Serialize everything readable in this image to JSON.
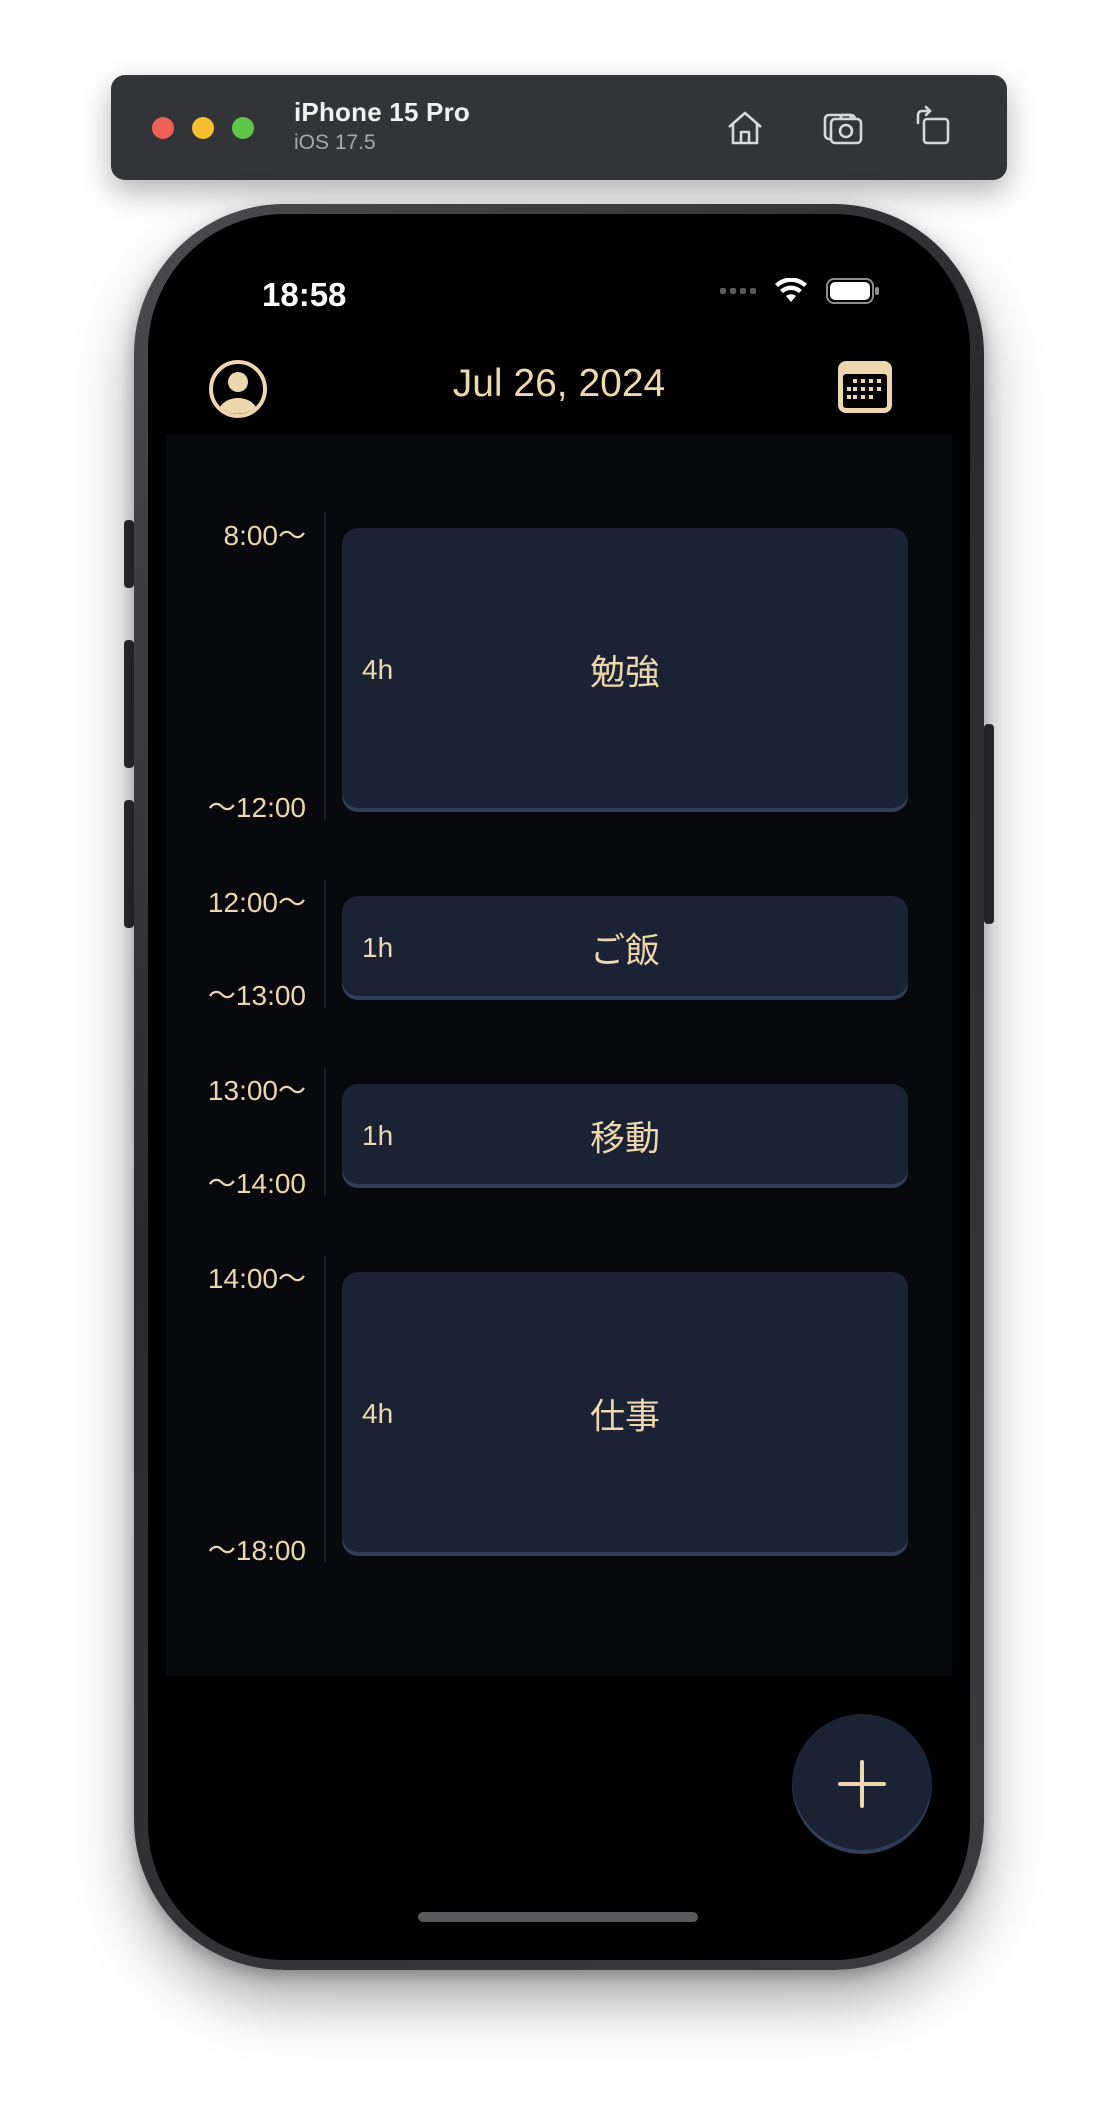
{
  "simulator": {
    "device_name": "iPhone 15 Pro",
    "os_version": "iOS 17.5",
    "buttons": [
      {
        "icon": "home-icon"
      },
      {
        "icon": "screenshot-icon"
      },
      {
        "icon": "rotate-icon"
      }
    ]
  },
  "status_bar": {
    "time": "18:58",
    "icons": [
      "cellular-signal-icon",
      "wifi-icon",
      "battery-icon"
    ]
  },
  "header": {
    "date": "Jul 26, 2024",
    "left_icon": "profile-icon",
    "right_icon": "calendar-icon"
  },
  "schedule": [
    {
      "start": "8:00〜",
      "end": "〜12:00",
      "duration": "4h",
      "title": "勉強"
    },
    {
      "start": "12:00〜",
      "end": "〜13:00",
      "duration": "1h",
      "title": "ご飯"
    },
    {
      "start": "13:00〜",
      "end": "〜14:00",
      "duration": "1h",
      "title": "移動"
    },
    {
      "start": "14:00〜",
      "end": "〜18:00",
      "duration": "4h",
      "title": "仕事"
    }
  ],
  "fab": {
    "icon": "plus-icon"
  },
  "colors": {
    "accent": "#ecd7ae",
    "card": "#1a2233",
    "card_border": "#2f3d58",
    "background": "#000000",
    "timeline_bg": "#07090d"
  }
}
